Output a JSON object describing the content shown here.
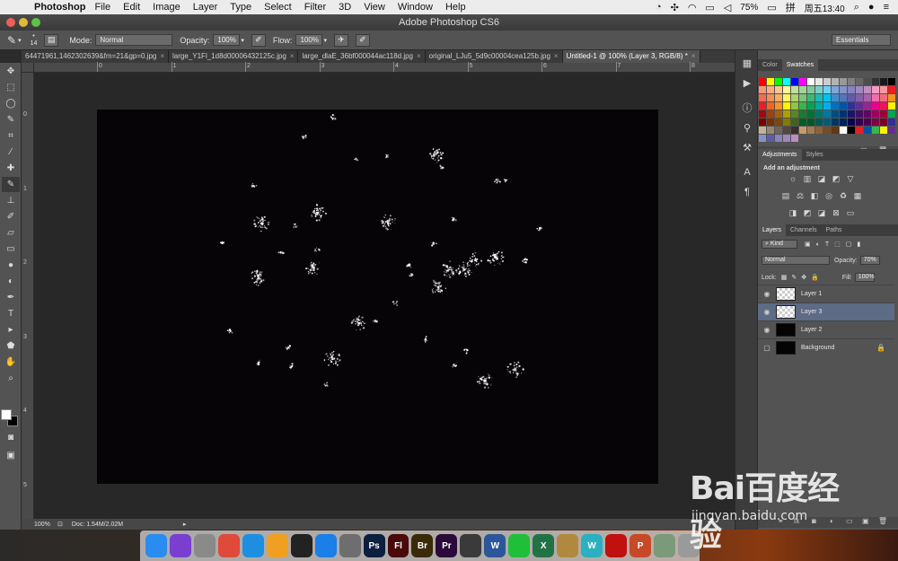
{
  "menubar": {
    "app_name": "Photoshop",
    "items": [
      "File",
      "Edit",
      "Image",
      "Layer",
      "Type",
      "Select",
      "Filter",
      "3D",
      "View",
      "Window",
      "Help"
    ],
    "battery": "75%",
    "clock": "周五13:40"
  },
  "window": {
    "title": "Adobe Photoshop CS6"
  },
  "options_bar": {
    "brush_size": "14",
    "mode_label": "Mode:",
    "mode_value": "Normal",
    "opacity_label": "Opacity:",
    "opacity_value": "100%",
    "flow_label": "Flow:",
    "flow_value": "100%",
    "workspace": "Essentials"
  },
  "tabs": [
    {
      "label": "64471961,1462302639&fm=21&gp=0.jpg"
    },
    {
      "label": "large_Y1Fl_1d8d00006432125c.jpg"
    },
    {
      "label": "large_dlaE_36bf000044ac118d.jpg"
    },
    {
      "label": "original_LJu5_5d9c00004cea125b.jpg"
    },
    {
      "label": "Untitled-1 @ 100% (Layer 3, RGB/8) *"
    }
  ],
  "ruler": {
    "top_labels": [
      "1",
      "0",
      "1",
      "2",
      "3",
      "4",
      "5",
      "6",
      "7",
      "8"
    ],
    "left_labels": [
      "0",
      "1",
      "2",
      "3",
      "4",
      "5"
    ]
  },
  "status": {
    "zoom": "100%",
    "doc": "Doc: 1.54M/2.02M"
  },
  "color_panel": {
    "tabs": [
      "Color",
      "Swatches"
    ],
    "swatch_rows": [
      [
        "#ff0000",
        "#ffff00",
        "#00ff00",
        "#00ffff",
        "#0000ff",
        "#ff00ff",
        "#ffffff",
        "#e6e6e6",
        "#cccccc",
        "#b3b3b3",
        "#999999",
        "#808080",
        "#666666",
        "#4d4d4d",
        "#333333",
        "#1a1a1a",
        "#000000"
      ],
      [
        "#f7977a",
        "#f9ad81",
        "#fdc68a",
        "#fff79a",
        "#c4df9b",
        "#a3d39c",
        "#82ca9d",
        "#7bcdc8",
        "#6ecff6",
        "#7ea7d8",
        "#8493ca",
        "#8882be",
        "#a187be",
        "#bc8dbf",
        "#f49ac2",
        "#f6989d",
        "#ed1c24"
      ],
      [
        "#f26c4f",
        "#f68e55",
        "#fbaf5c",
        "#fff467",
        "#acd372",
        "#7cc576",
        "#3bb878",
        "#1abbb4",
        "#00bff3",
        "#438ccb",
        "#5574b9",
        "#605ca8",
        "#855fa8",
        "#a763a8",
        "#f06ea9",
        "#f26d7d",
        "#f7941d"
      ],
      [
        "#ed1c24",
        "#f26522",
        "#f7941d",
        "#fff200",
        "#8dc73f",
        "#39b54a",
        "#00a651",
        "#00a99d",
        "#00aeef",
        "#0072bc",
        "#0054a6",
        "#2e3192",
        "#662d91",
        "#92278f",
        "#ec008c",
        "#ed145b",
        "#fff200"
      ],
      [
        "#9e0b0f",
        "#a0410d",
        "#a36209",
        "#aba000",
        "#598527",
        "#1a7b30",
        "#007236",
        "#00746b",
        "#0076a3",
        "#004b80",
        "#003471",
        "#1b1464",
        "#440e62",
        "#630460",
        "#9e005d",
        "#9e0039",
        "#00a651"
      ],
      [
        "#790000",
        "#7b2e00",
        "#7d4900",
        "#827b00",
        "#406618",
        "#005e20",
        "#005826",
        "#005952",
        "#005b7f",
        "#003663",
        "#002157",
        "#0d004c",
        "#32004b",
        "#4b0049",
        "#7b0046",
        "#7a0026",
        "#2e3192"
      ],
      [
        "#c7b299",
        "#998675",
        "#736357",
        "#534741",
        "#37302d",
        "#c69c6d",
        "#a67c52",
        "#8c6239",
        "#754c24",
        "#603913",
        "#ffffff",
        "#000000",
        "#ed1c24",
        "#0054a6",
        "#39b54a",
        "#fff200",
        "#662d91"
      ],
      [
        "#8493ca",
        "#605ca8",
        "#8882be",
        "#a187be",
        "#bc8dbf"
      ]
    ]
  },
  "adjustments": {
    "tabs": [
      "Adjustments",
      "Styles"
    ],
    "title": "Add an adjustment"
  },
  "layers_panel": {
    "tabs": [
      "Layers",
      "Channels",
      "Paths"
    ],
    "kind_label": "Kind",
    "blend_mode": "Normal",
    "opacity_label": "Opacity:",
    "opacity_value": "70%",
    "lock_label": "Lock:",
    "fill_label": "Fill:",
    "fill_value": "100%",
    "layers": [
      {
        "name": "Layer 1",
        "visible": true,
        "thumb": "transparent",
        "selected": false
      },
      {
        "name": "Layer 3",
        "visible": true,
        "thumb": "transparent",
        "selected": true
      },
      {
        "name": "Layer 2",
        "visible": true,
        "thumb": "black",
        "selected": false
      },
      {
        "name": "Background",
        "visible": false,
        "thumb": "black",
        "selected": false,
        "locked": true
      }
    ]
  },
  "dock": {
    "apps": [
      {
        "icon": "finder-icon",
        "label": "",
        "color": "#2a8cf0"
      },
      {
        "icon": "siri-icon",
        "label": "",
        "color": "#7a3fd0"
      },
      {
        "icon": "launchpad-icon",
        "label": "",
        "color": "#8a8a8a"
      },
      {
        "icon": "chrome-icon",
        "label": "",
        "color": "#e04a3a"
      },
      {
        "icon": "safari-icon",
        "label": "",
        "color": "#1e8fe0"
      },
      {
        "icon": "photos-icon",
        "label": "",
        "color": "#f0a020"
      },
      {
        "icon": "qq-icon",
        "label": "",
        "color": "#222222"
      },
      {
        "icon": "appstore-icon",
        "label": "",
        "color": "#1a7fe8"
      },
      {
        "icon": "settings-icon",
        "label": "",
        "color": "#6e6e6e"
      },
      {
        "icon": "photoshop-icon",
        "label": "Ps",
        "color": "#0c1f3f"
      },
      {
        "icon": "flash-icon",
        "label": "Fl",
        "color": "#4a0a0a"
      },
      {
        "icon": "bridge-icon",
        "label": "Br",
        "color": "#3a2a08"
      },
      {
        "icon": "premiere-icon",
        "label": "Pr",
        "color": "#2a0a3a"
      },
      {
        "icon": "quicktime-icon",
        "label": "",
        "color": "#3a3a3a"
      },
      {
        "icon": "word-icon",
        "label": "W",
        "color": "#2b579a"
      },
      {
        "icon": "iqiyi-icon",
        "label": "",
        "color": "#1fbf3a"
      },
      {
        "icon": "excel-icon",
        "label": "X",
        "color": "#217346"
      },
      {
        "icon": "archive-icon",
        "label": "",
        "color": "#b08840"
      },
      {
        "icon": "wps-icon",
        "label": "W",
        "color": "#2ab0c0"
      },
      {
        "icon": "flashplayer-icon",
        "label": "",
        "color": "#c01010"
      },
      {
        "icon": "powerpoint-icon",
        "label": "P",
        "color": "#c64a28"
      },
      {
        "icon": "screenshot-icon",
        "label": "",
        "color": "#7a9a7a"
      },
      {
        "icon": "trash-icon",
        "label": "",
        "color": "#9a9a9a"
      }
    ]
  },
  "watermark": {
    "brand": "Bai百度经验",
    "url": "jingyan.baidu.com"
  }
}
